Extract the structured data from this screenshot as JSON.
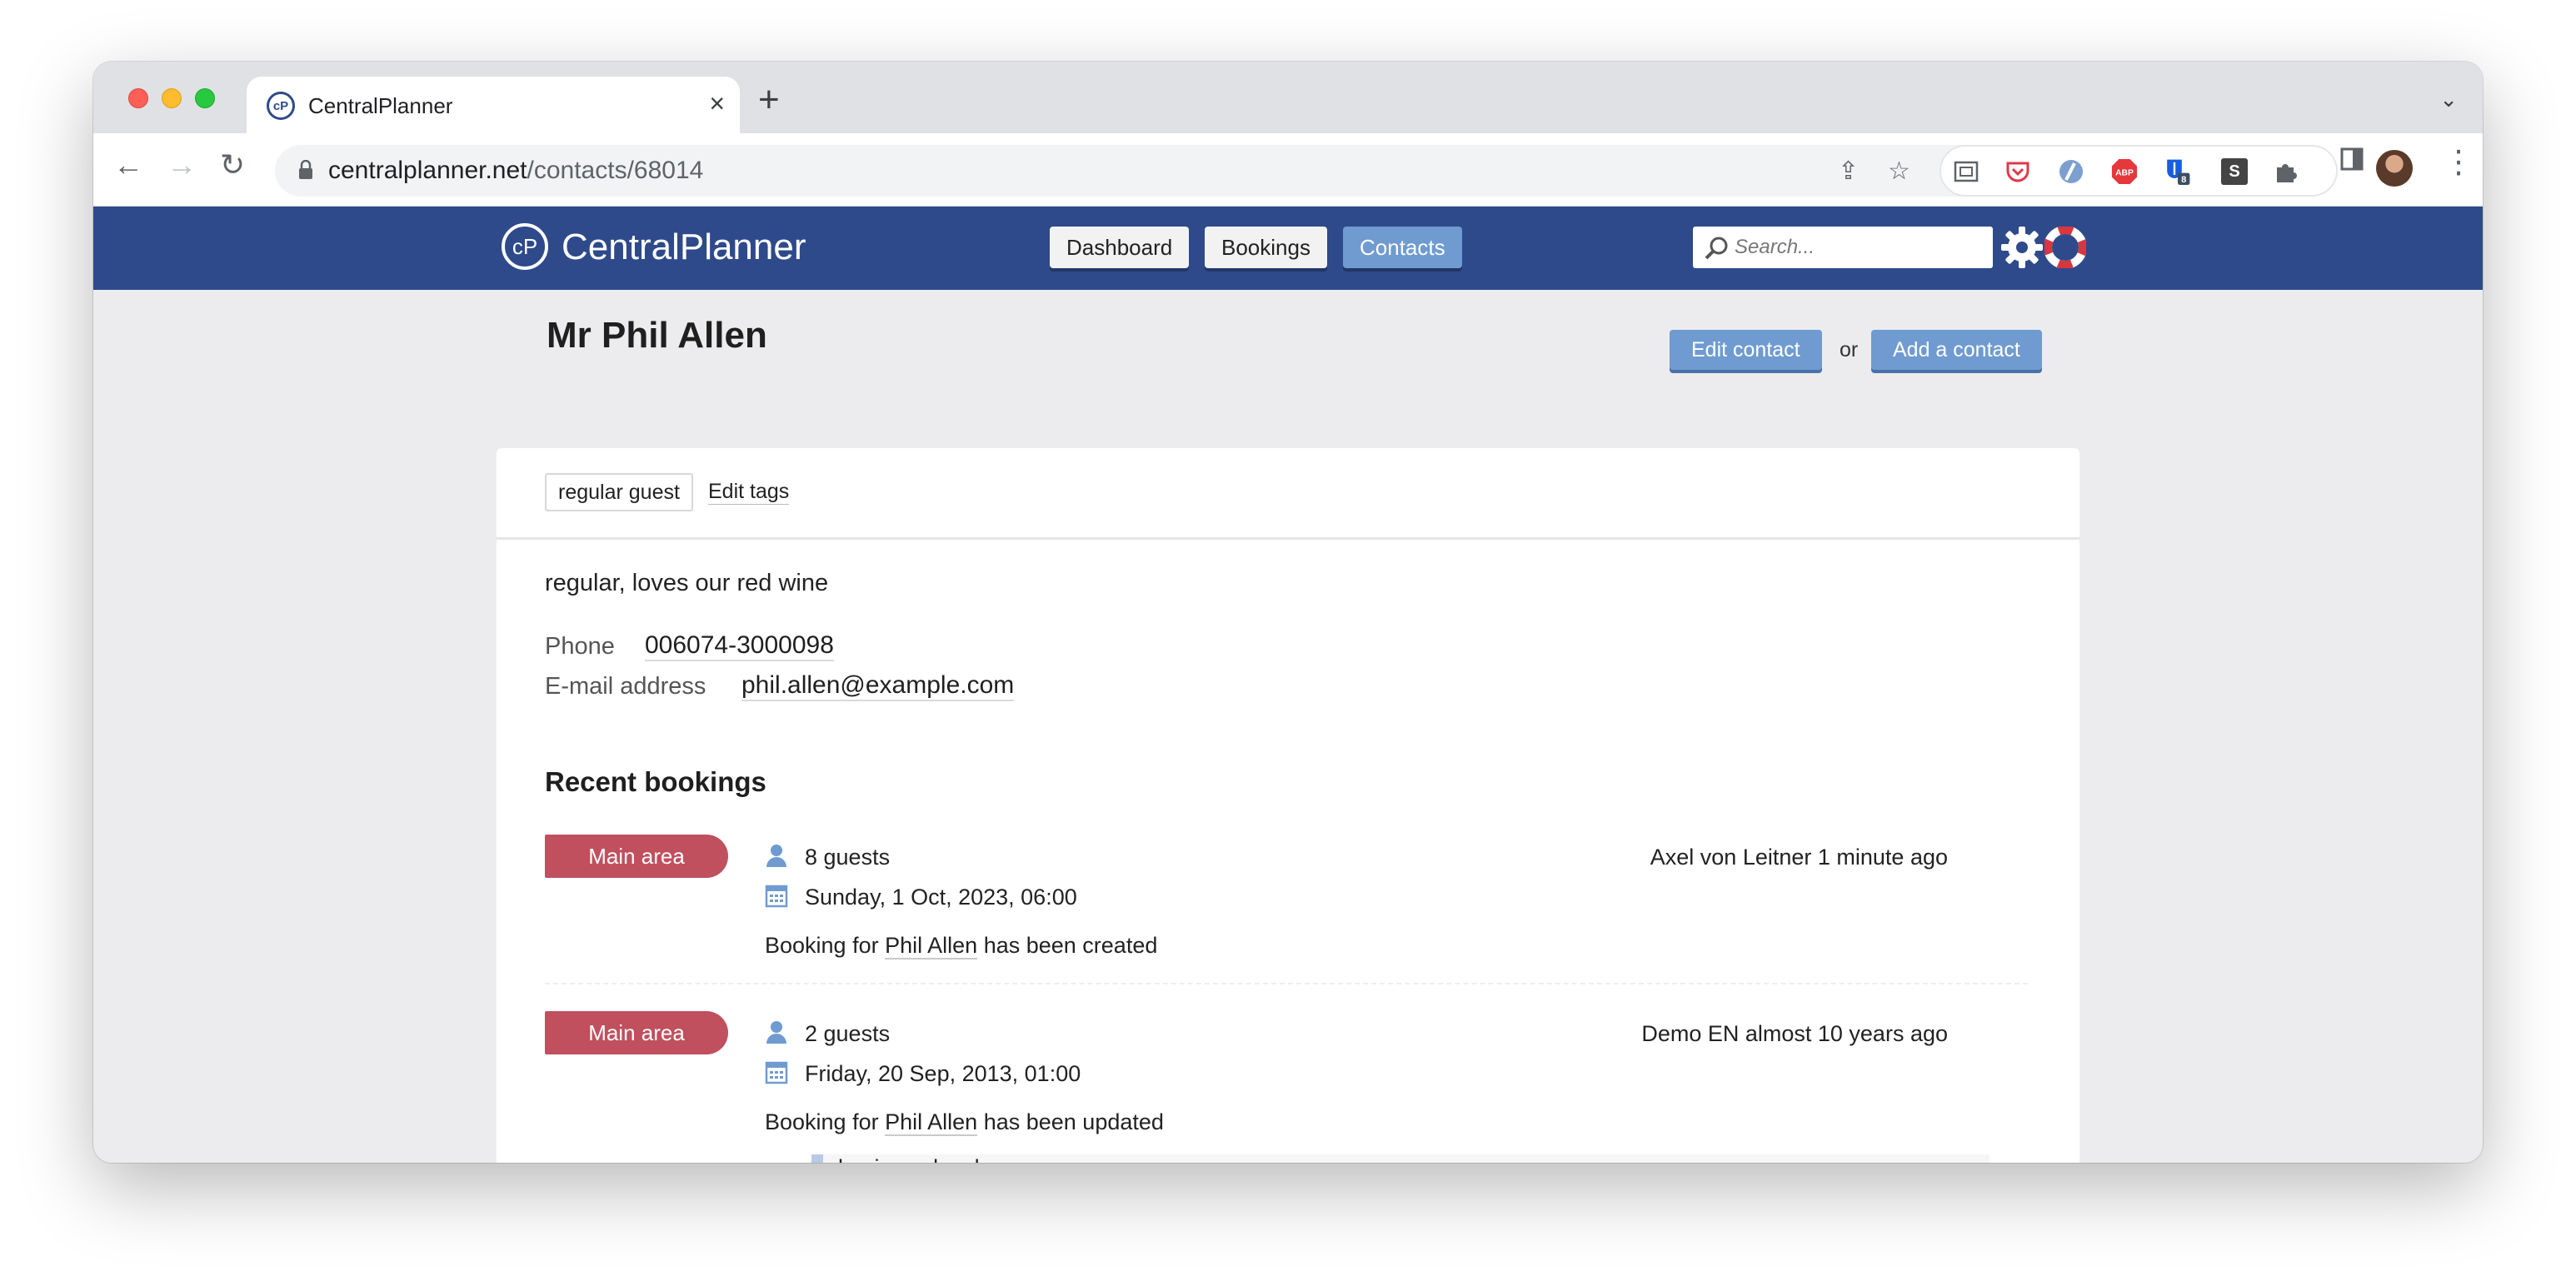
{
  "browser": {
    "tab_title": "CentralPlanner",
    "tab_favicon": "cP",
    "url_host": "centralplanner.net",
    "url_path": "/contacts/68014",
    "extensions": [
      "screenshot-icon",
      "pocket-icon",
      "ext-blue-icon",
      "adblock-icon",
      "bitwarden-icon",
      "s-ext-icon",
      "puzzle-icon"
    ],
    "abp_label": "ABP",
    "bitwarden_badge": "8",
    "s_ext_label": "S"
  },
  "app": {
    "logo_mark": "cP",
    "logo_text": "CentralPlanner",
    "nav": [
      "Dashboard",
      "Bookings",
      "Contacts"
    ],
    "active_nav": "Contacts",
    "search_placeholder": "Search...",
    "brand_color": "#2e4a8b",
    "accent_color": "#6f9bd0",
    "badge_color": "#c0505e"
  },
  "contact": {
    "name": "Mr Phil Allen",
    "edit_button": "Edit contact",
    "or_text": "or",
    "add_button": "Add a contact",
    "tags": [
      "regular guest"
    ],
    "edit_tags_label": "Edit tags",
    "notes": "regular, loves our red wine",
    "phone_label": "Phone",
    "phone": "006074-3000098",
    "email_label": "E-mail address",
    "email": "phil.allen@example.com"
  },
  "bookings": {
    "title": "Recent bookings",
    "items": [
      {
        "area": "Main area",
        "guests": "8 guests",
        "datetime": "Sunday, 1 Oct, 2023, 06:00",
        "by": "Axel von Leitner 1 minute ago",
        "msg_prefix": "Booking for",
        "msg_name": "Phil Allen",
        "msg_suffix": "has been created",
        "note": ""
      },
      {
        "area": "Main area",
        "guests": "2 guests",
        "datetime": "Friday, 20 Sep, 2013, 01:00",
        "by": "Demo EN almost 10 years ago",
        "msg_prefix": "Booking for",
        "msg_name": "Phil Allen",
        "msg_suffix": "has been updated",
        "note": "business lunch"
      }
    ]
  }
}
